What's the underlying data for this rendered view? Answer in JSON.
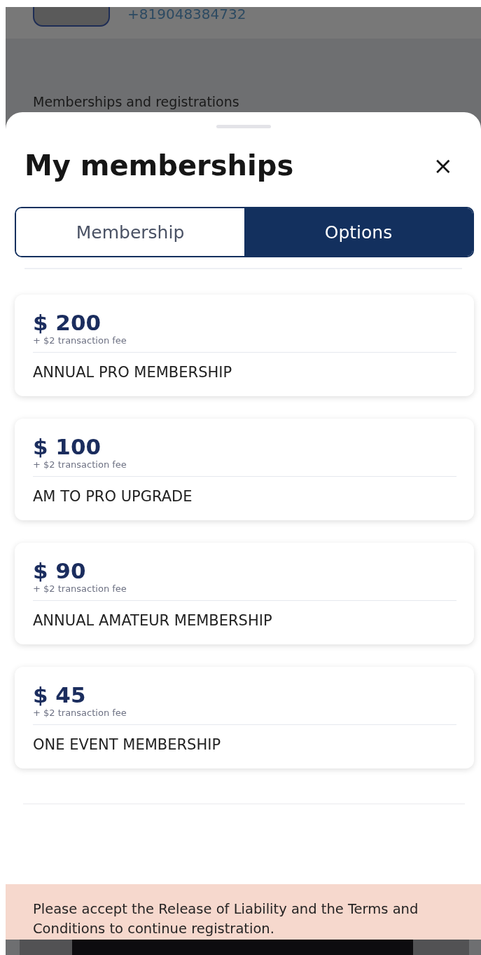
{
  "background": {
    "phone": "+819048384732",
    "section_title": "Memberships and registrations"
  },
  "sheet": {
    "title": "My memberships",
    "close": "×",
    "tabs": [
      {
        "label": "Membership",
        "selected": false
      },
      {
        "label": "Options",
        "selected": true
      }
    ],
    "options": [
      {
        "price": "$ 200",
        "fee": "+ $2 transaction fee",
        "name": "ANNUAL PRO MEMBERSHIP"
      },
      {
        "price": "$ 100",
        "fee": "+ $2 transaction fee",
        "name": "AM TO PRO UPGRADE"
      },
      {
        "price": "$ 90",
        "fee": "+ $2 transaction fee",
        "name": "ANNUAL AMATEUR MEMBERSHIP"
      },
      {
        "price": "$ 45",
        "fee": "+ $2 transaction fee",
        "name": "ONE EVENT MEMBERSHIP"
      }
    ]
  },
  "banner": {
    "message": "Please accept the Release of Liability and the Terms and Conditions to continue registration."
  }
}
